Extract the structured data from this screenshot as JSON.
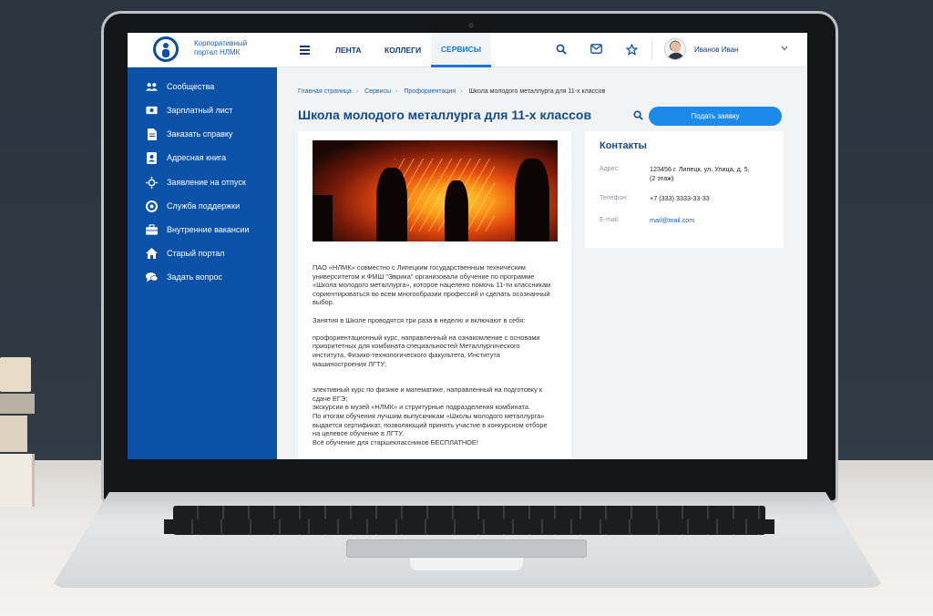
{
  "header": {
    "logo_text": "Корпоративный портал НЛМК",
    "tabs": [
      {
        "label": "ЛЕНТА"
      },
      {
        "label": "КОЛЛЕГИ"
      },
      {
        "label": "СЕРВИСЫ"
      }
    ],
    "active_tab": "СЕРВИСЫ",
    "user_name": "Иванов Иван"
  },
  "sidebar": {
    "items": [
      {
        "label": "Сообщества",
        "icon": "users-icon"
      },
      {
        "label": "Зарплатный лист",
        "icon": "money-icon"
      },
      {
        "label": "Заказать справку",
        "icon": "document-icon"
      },
      {
        "label": "Адресная книга",
        "icon": "address-book-icon"
      },
      {
        "label": "Заявление на отпуск",
        "icon": "sun-icon"
      },
      {
        "label": "Служба поддержки",
        "icon": "lifebuoy-icon"
      },
      {
        "label": "Внутренние вакансии",
        "icon": "briefcase-icon"
      },
      {
        "label": "Старый портал",
        "icon": "home-icon"
      },
      {
        "label": "Задать вопрос",
        "icon": "chat-icon"
      }
    ]
  },
  "breadcrumb": {
    "items": [
      "Главная страница",
      "Сервисы",
      "Профориентация"
    ],
    "current": "Школа молодого металлурга для 11-х классов"
  },
  "page": {
    "title": "Школа молодого металлурга для 11-х классов",
    "apply_button": "Подать заявку"
  },
  "article": {
    "paragraphs": [
      "ПАО «НЛМК» совместно с Липецким государственным техническим\nуниверситетом и ФМШ \"Эврика\" организовали обучение по программе\n«Школа молодого металлурга», которое нацелено помочь 11-ти классникам\nсориентироваться во всем многообразии профессий и сделать осознанный\nвыбор.",
      "Занятия в Школе проводятся три раза в неделю и включают в себя:",
      "профориентационный курс, направленный на ознакомление с основами\nприоритетных для комбината специальностей Металлургического\nинститута, Физико-технологического факультета, Института\nмашиностроения ЛГТУ;",
      "элективный курс по физике и математике, направленный на подготовку к\nсдаче ЕГЭ;\nэкскурсии в музей «НЛМК» и структурные подразделения комбината.\nПо итогам обучения лучшим выпускникам «Школы молодого металлурга»\nвыдается сертификат, позволяющий принять участие в конкурсном отборе\nна целевое обучение в ЛГТУ.\nВсё обучение для старшеклассников БЕСПЛАТНОЕ!"
    ]
  },
  "contacts": {
    "title": "Контакты",
    "address_label": "Адрес:",
    "address_value": "123456 г. Липецк, ул. Улица, д. 5,\n(2 этаж)",
    "phone_label": "Телефон:",
    "phone_value": "+7 (333) 3333-33-33",
    "email_label": "E-mail:",
    "email_value": "mail@mail.com"
  },
  "colors": {
    "brand_blue": "#0a52a8",
    "accent_button": "#1b8ae8",
    "title_blue": "#124a8e"
  }
}
